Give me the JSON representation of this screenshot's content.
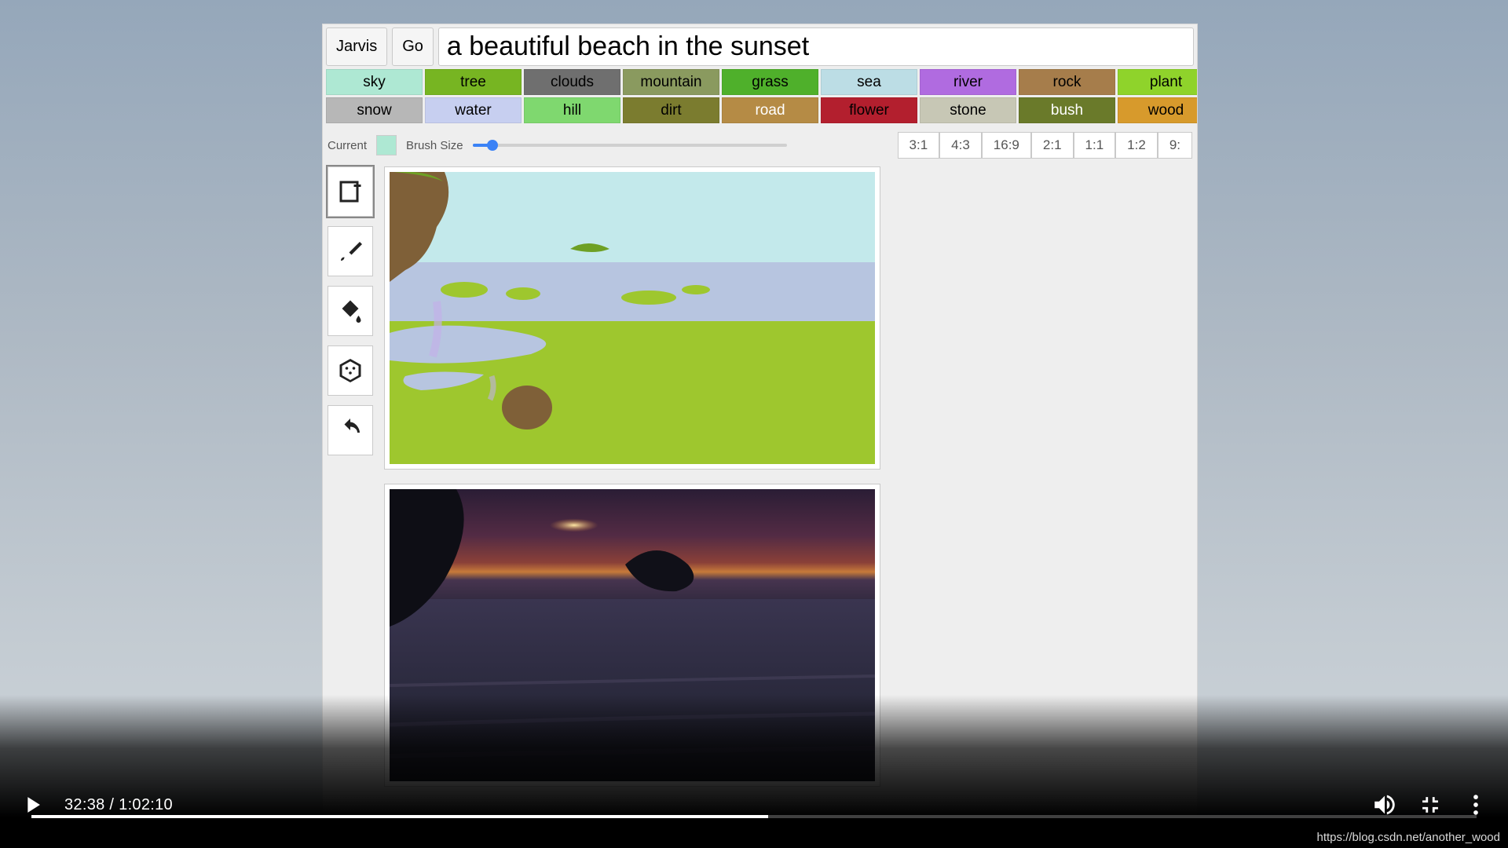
{
  "app": {
    "jarvis_label": "Jarvis",
    "go_label": "Go",
    "prompt_value": "a beautiful beach in the sunset",
    "palette_row1": [
      {
        "label": "sky",
        "bg": "#aee8d3"
      },
      {
        "label": "tree",
        "bg": "#77b522"
      },
      {
        "label": "clouds",
        "bg": "#6f6f6f"
      },
      {
        "label": "mountain",
        "bg": "#8a9a5f"
      },
      {
        "label": "grass",
        "bg": "#4fb02b"
      },
      {
        "label": "sea",
        "bg": "#bcdde5"
      },
      {
        "label": "river",
        "bg": "#b06be0"
      },
      {
        "label": "rock",
        "bg": "#a67d4b"
      },
      {
        "label": "plant",
        "bg": "#8fd32b"
      }
    ],
    "palette_row2": [
      {
        "label": "snow",
        "bg": "#b7b7b7"
      },
      {
        "label": "water",
        "bg": "#c7cff0"
      },
      {
        "label": "hill",
        "bg": "#7fd86f"
      },
      {
        "label": "dirt",
        "bg": "#7b7c2f"
      },
      {
        "label": "road",
        "bg": "#b58b45",
        "fg": "#ffffff"
      },
      {
        "label": "flower",
        "bg": "#b31f2e",
        "fg": "#000000"
      },
      {
        "label": "stone",
        "bg": "#c7c7b5"
      },
      {
        "label": "bush",
        "bg": "#6a7a2a",
        "fg": "#ffffff"
      },
      {
        "label": "wood",
        "bg": "#d79a2c"
      }
    ],
    "current_label": "Current",
    "brush_label": "Brush Size",
    "aspect_ratios": [
      "3:1",
      "4:3",
      "16:9",
      "2:1",
      "1:1",
      "1:2",
      "9:"
    ],
    "tools": [
      {
        "name": "new-canvas-tool",
        "glyph": "new",
        "selected": true
      },
      {
        "name": "brush-tool",
        "glyph": "brush",
        "selected": false
      },
      {
        "name": "fill-tool",
        "glyph": "fill",
        "selected": false
      },
      {
        "name": "dice-tool",
        "glyph": "dice",
        "selected": false
      },
      {
        "name": "undo-tool",
        "glyph": "undo",
        "selected": false
      }
    ]
  },
  "player": {
    "current_time": "32:38",
    "separator": " / ",
    "duration": "1:02:10",
    "url_hint": "https://blog.csdn.net/another_wood"
  }
}
